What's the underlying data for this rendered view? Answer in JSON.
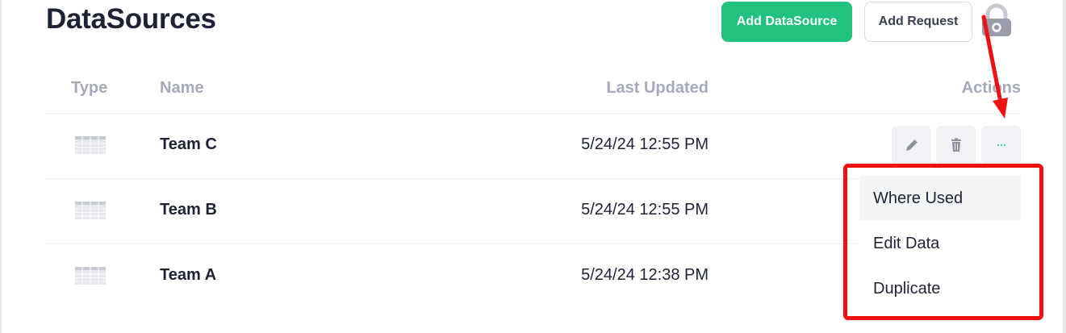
{
  "page": {
    "title": "DataSources"
  },
  "toolbar": {
    "add_datasource_label": "Add DataSource",
    "add_request_label": "Add Request",
    "lock_icon": "lock-icon"
  },
  "table": {
    "headers": {
      "type": "Type",
      "name": "Name",
      "last_updated": "Last Updated",
      "actions": "Actions"
    },
    "rows": [
      {
        "type_icon": "table-grid-icon",
        "name": "Team C",
        "last_updated": "5/24/24 12:55 PM"
      },
      {
        "type_icon": "table-grid-icon",
        "name": "Team B",
        "last_updated": "5/24/24 12:55 PM"
      },
      {
        "type_icon": "table-grid-icon",
        "name": "Team A",
        "last_updated": "5/24/24 12:38 PM"
      }
    ]
  },
  "actions_menu": {
    "items": [
      {
        "label": "Where Used",
        "active": true
      },
      {
        "label": "Edit Data",
        "active": false
      },
      {
        "label": "Duplicate",
        "active": false
      }
    ]
  },
  "colors": {
    "primary_button": "#21c17f",
    "annotation_red": "#ee1111",
    "header_text": "#a5a9ba"
  }
}
